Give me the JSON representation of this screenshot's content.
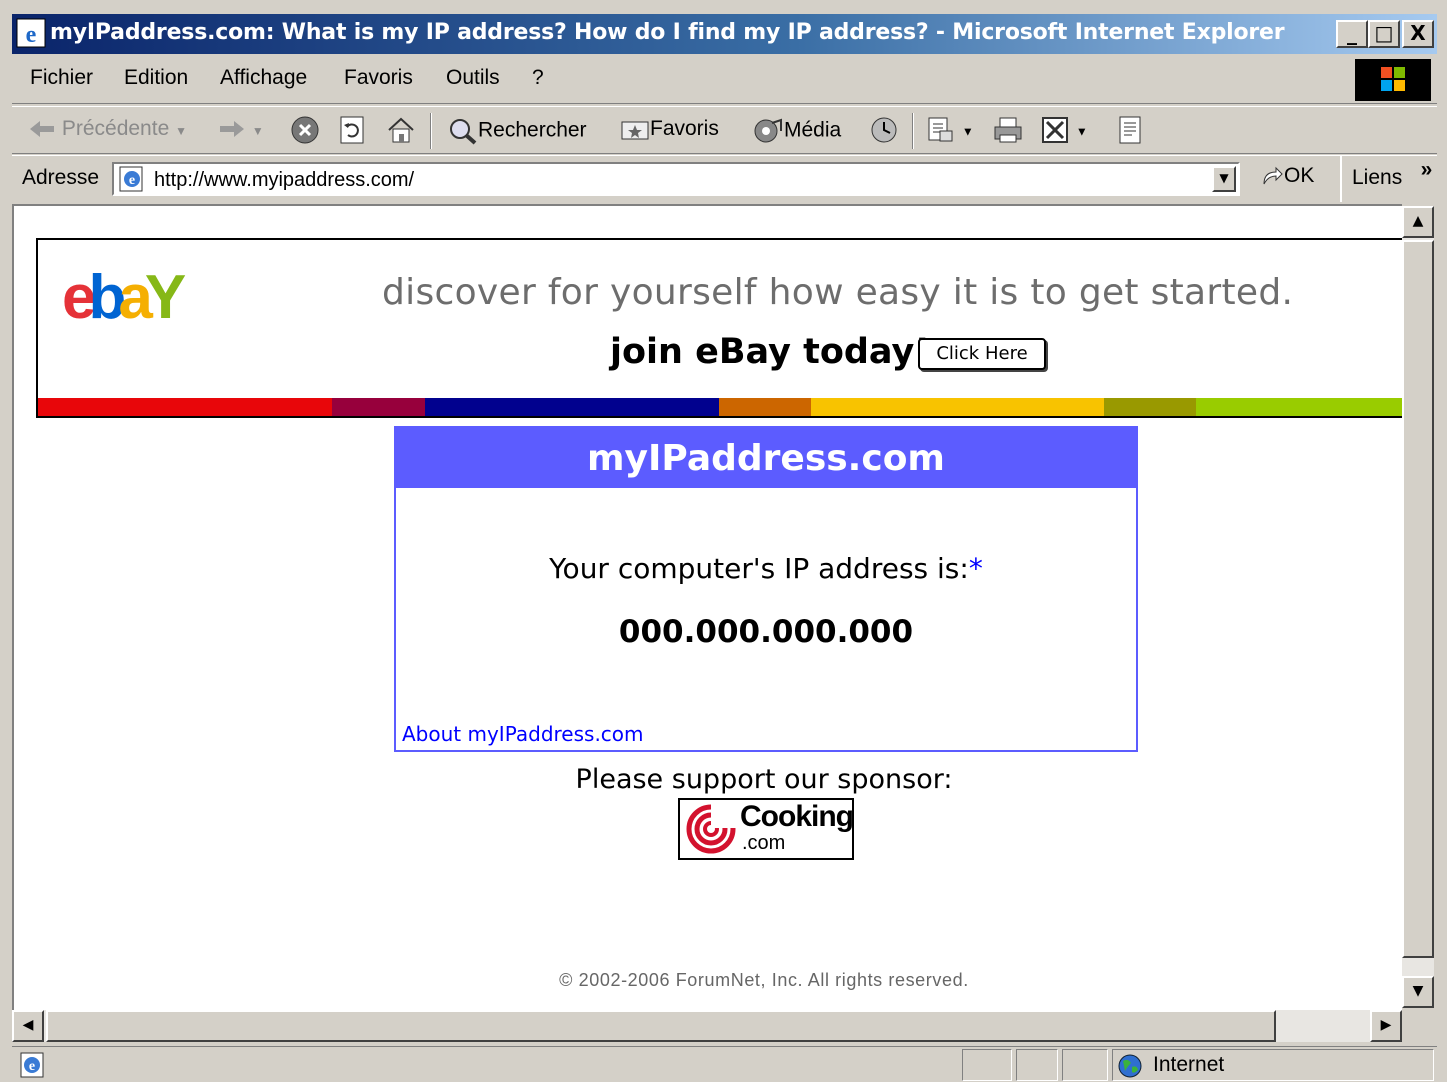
{
  "window": {
    "title": "myIPaddress.com: What is my IP address? How do I find my IP address? - Microsoft Internet Explorer",
    "minimize": "_",
    "maximize": "□",
    "close": "X"
  },
  "menu": {
    "items": [
      "Fichier",
      "Edition",
      "Affichage",
      "Favoris",
      "Outils",
      "?"
    ]
  },
  "toolbar": {
    "back_label": "Précédente",
    "search_label": "Rechercher",
    "favorites_label": "Favoris",
    "media_label": "Média"
  },
  "address": {
    "label": "Adresse",
    "url": "http://www.myipaddress.com/",
    "go_label": "OK",
    "links_label": "Liens",
    "links_chevron": "»"
  },
  "banner": {
    "logo_letters": [
      "e",
      "b",
      "a",
      "Y"
    ],
    "logo_colors": [
      "#e53238",
      "#0064d2",
      "#f5af02",
      "#86b817"
    ],
    "tagline": "discover for yourself how easy it is to get started.",
    "join_text": "join eBay today!",
    "button_label": "Click Here",
    "stripe_colors": [
      "#e8060a",
      "#97003c",
      "#01018e",
      "#cc6600",
      "#f8c300",
      "#999900",
      "#99cc00"
    ]
  },
  "ip_box": {
    "heading": "myIPaddress.com",
    "label": "Your computer's IP address is:",
    "label_marker": "*",
    "ip_value": "000.000.000.000",
    "about_link": "About myIPaddress.com",
    "accent_color": "#5c5cff"
  },
  "sponsor": {
    "text": "Please support our sponsor:",
    "logo_word": "Cooking",
    "logo_suffix": ".com"
  },
  "footer": {
    "copyright": "© 2002-2006 ForumNet, Inc. All rights reserved."
  },
  "status": {
    "zone": "Internet"
  }
}
